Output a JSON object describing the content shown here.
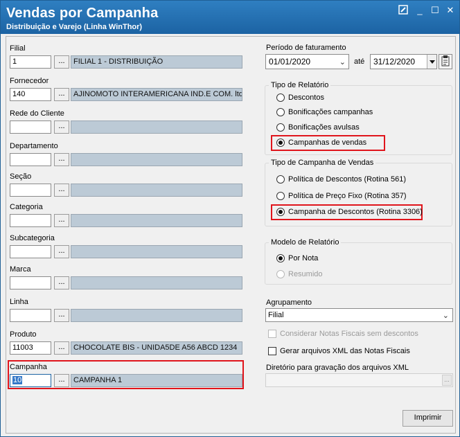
{
  "window": {
    "title": "Vendas por Campanha",
    "subtitle": "Distribuição e Varejo (Linha WinThor)",
    "min_glyph": "_",
    "max_glyph": "☐",
    "close_glyph": "✕"
  },
  "filters": {
    "ellipsis": "...",
    "filial": {
      "label": "Filial",
      "code": "1",
      "desc": "FILIAL 1 - DISTRIBUIÇÃO"
    },
    "fornecedor": {
      "label": "Fornecedor",
      "code": "140",
      "desc": "AJINOMOTO INTERAMERICANA IND.E COM. ltda"
    },
    "rede": {
      "label": "Rede do Cliente",
      "code": "",
      "desc": ""
    },
    "departamento": {
      "label": "Departamento",
      "code": "",
      "desc": ""
    },
    "secao": {
      "label": "Seção",
      "code": "",
      "desc": ""
    },
    "categoria": {
      "label": "Categoria",
      "code": "",
      "desc": ""
    },
    "subcategoria": {
      "label": "Subcategoria",
      "code": "",
      "desc": ""
    },
    "marca": {
      "label": "Marca",
      "code": "",
      "desc": ""
    },
    "linha": {
      "label": "Linha",
      "code": "",
      "desc": ""
    },
    "produto": {
      "label": "Produto",
      "code": "11003",
      "desc": "CHOCOLATE BIS - UNIDA5DE A56 ABCD 1234"
    },
    "campanha": {
      "label": "Campanha",
      "code": "10",
      "desc": "CAMPANHA 1"
    }
  },
  "periodo": {
    "label": "Período de faturamento",
    "start": "01/01/2020",
    "ate_label": "até",
    "end": "31/12/2020"
  },
  "tipo_relatorio": {
    "title": "Tipo de Relatório",
    "options": [
      "Descontos",
      "Bonificações campanhas",
      "Bonificações avulsas",
      "Campanhas de vendas"
    ],
    "selected": "Campanhas de vendas"
  },
  "tipo_campanha": {
    "title": "Tipo de Campanha de Vendas",
    "options": [
      "Política de Descontos (Rotina 561)",
      "Política de Preço Fixo (Rotina 357)",
      "Campanha de Descontos (Rotina 3306)"
    ],
    "selected": "Campanha de Descontos (Rotina 3306)"
  },
  "modelo": {
    "title": "Modelo de Relatório",
    "options": [
      "Por Nota",
      "Resumido"
    ],
    "selected": "Por Nota"
  },
  "agrupamento": {
    "label": "Agrupamento",
    "value": "Filial"
  },
  "checks": {
    "considerar": "Considerar Notas Fiscais sem descontos",
    "gerar_xml": "Gerar arquivos XML das Notas Fiscais"
  },
  "diretorio": {
    "label": "Diretório para gravação dos arquivos XML",
    "value": ""
  },
  "buttons": {
    "imprimir": "Imprimir"
  },
  "colors": {
    "title_bar": "#1c63a3",
    "highlight": "#e0141b",
    "desc_field": "#bccad6"
  }
}
